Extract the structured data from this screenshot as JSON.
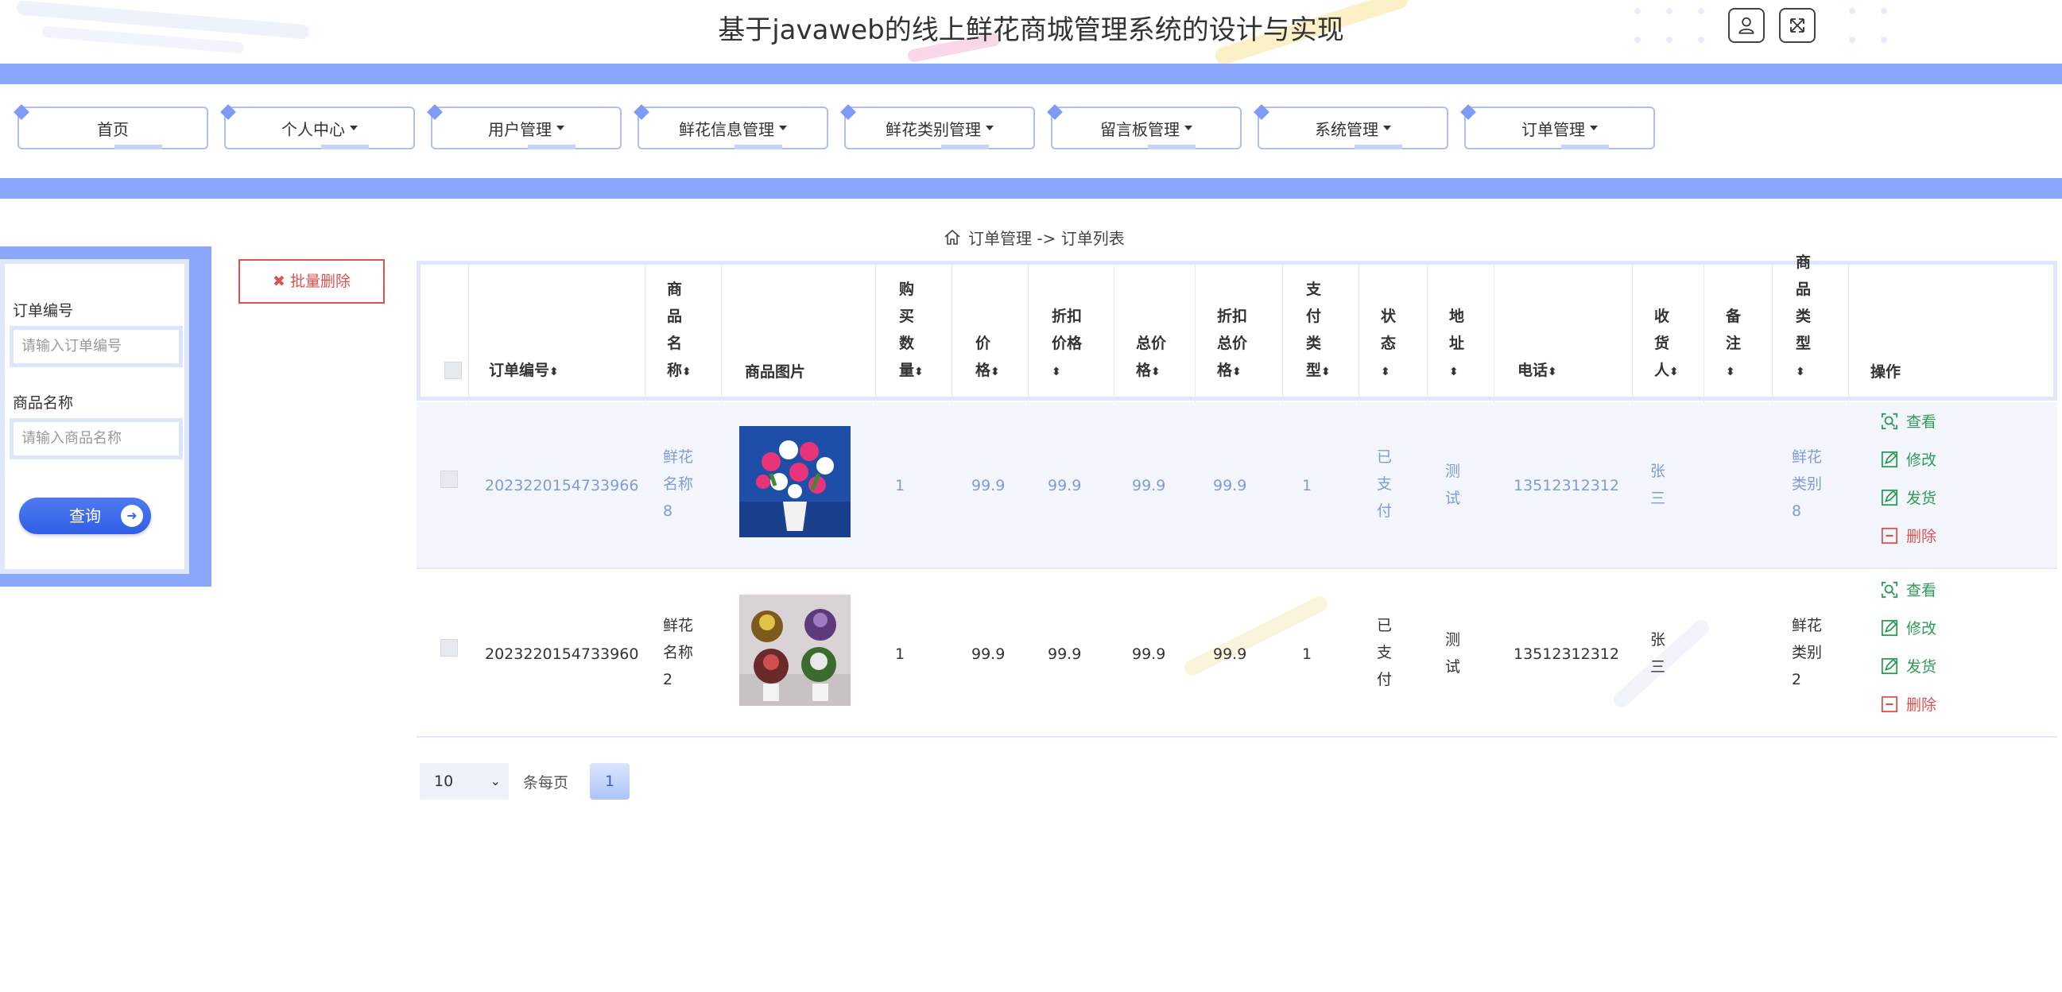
{
  "header": {
    "title": "基于javaweb的线上鲜花商城管理系统的设计与实现",
    "user_icon": "user-icon",
    "fullscreen_icon": "fullscreen-icon"
  },
  "nav": {
    "items": [
      {
        "label": "首页",
        "dropdown": false
      },
      {
        "label": "个人中心",
        "dropdown": true
      },
      {
        "label": "用户管理",
        "dropdown": true
      },
      {
        "label": "鲜花信息管理",
        "dropdown": true
      },
      {
        "label": "鲜花类别管理",
        "dropdown": true
      },
      {
        "label": "留言板管理",
        "dropdown": true
      },
      {
        "label": "系统管理",
        "dropdown": true
      },
      {
        "label": "订单管理",
        "dropdown": true
      }
    ]
  },
  "breadcrumb": {
    "home_icon": "home-icon",
    "text": "订单管理 -> 订单列表"
  },
  "search": {
    "order_no_label": "订单编号",
    "order_no_placeholder": "请输入订单编号",
    "product_name_label": "商品名称",
    "product_name_placeholder": "请输入商品名称",
    "query_label": "查询"
  },
  "toolbar": {
    "batch_delete_label": "批量删除"
  },
  "table": {
    "columns": {
      "order_no": "订单编号",
      "product_name": "商品名称",
      "product_image": "商品图片",
      "quantity": "购买数量",
      "price": "价格",
      "discount_price": "折扣价格",
      "total": "总价格",
      "discount_total": "折扣总价格",
      "pay_type": "支付类型",
      "status": "状态",
      "address": "地址",
      "phone": "电话",
      "receiver": "收货人",
      "remark": "备注",
      "product_type": "商品类型",
      "actions": "操作"
    },
    "rows": [
      {
        "order_no": "2023220154733966",
        "product_name": "鲜花名称8",
        "quantity": "1",
        "price": "99.9",
        "discount_price": "99.9",
        "total": "99.9",
        "discount_total": "99.9",
        "pay_type": "1",
        "status": "已支付",
        "address": "测试",
        "phone": "13512312312",
        "receiver": "张三",
        "remark": "",
        "product_type": "鲜花类别8"
      },
      {
        "order_no": "2023220154733960",
        "product_name": "鲜花名称2",
        "quantity": "1",
        "price": "99.9",
        "discount_price": "99.9",
        "total": "99.9",
        "discount_total": "99.9",
        "pay_type": "1",
        "status": "已支付",
        "address": "测试",
        "phone": "13512312312",
        "receiver": "张三",
        "remark": "",
        "product_type": "鲜花类别2"
      }
    ],
    "actions": {
      "view": "查看",
      "edit": "修改",
      "ship": "发货",
      "delete": "删除"
    }
  },
  "pager": {
    "page_size": "10",
    "per_page_label": "条每页",
    "current_page": "1"
  },
  "colors": {
    "accent": "#8aa7fb",
    "primary_button": "#3a66ea",
    "danger": "#d9534f",
    "success": "#2e9a57",
    "link_text_highlight": "#6b8fd8"
  }
}
